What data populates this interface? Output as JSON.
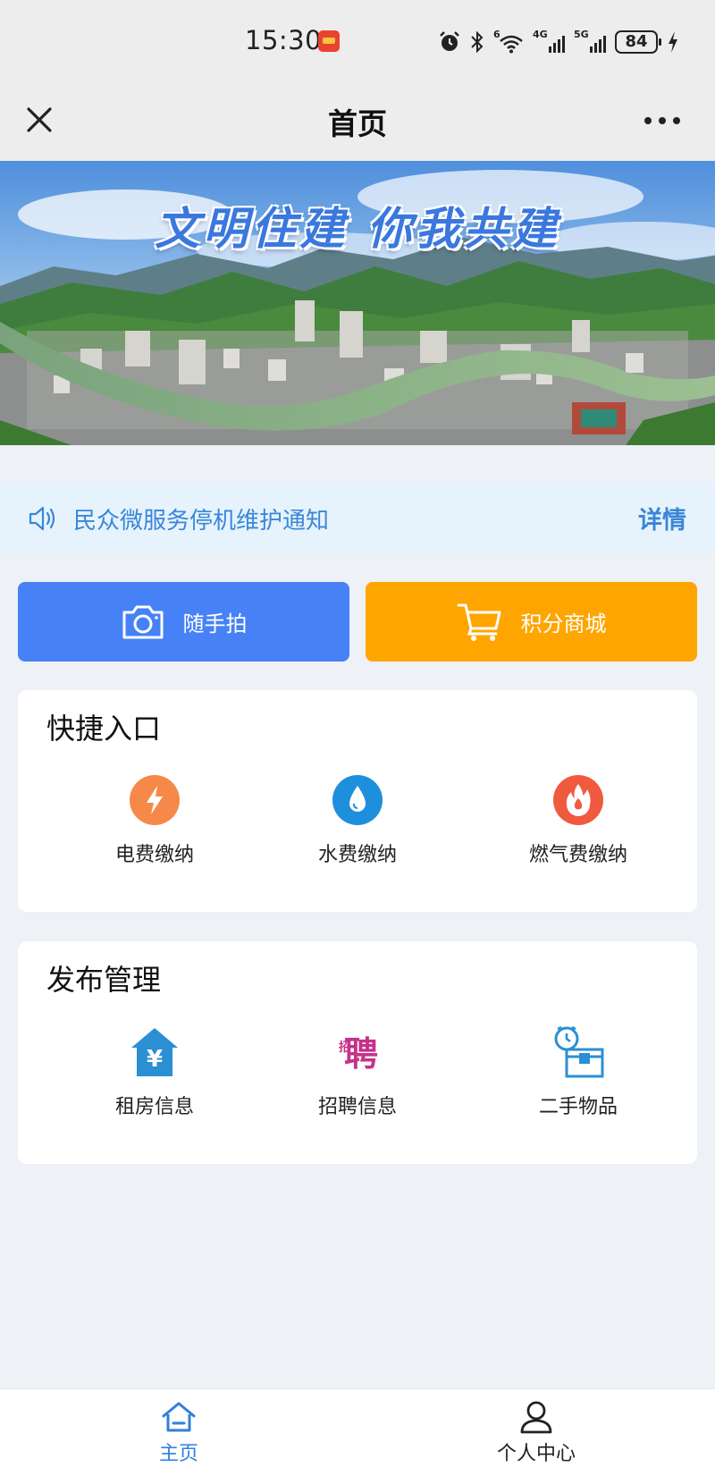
{
  "status_bar": {
    "time": "15:30",
    "net1_label": "4G",
    "net2_label": "5G",
    "battery": "84",
    "wifi_label": "6"
  },
  "nav": {
    "title": "首页"
  },
  "banner": {
    "slogan": "文明住建  你我共建"
  },
  "notice": {
    "text": "民众微服务停机维护通知",
    "detail_label": "详情"
  },
  "actions": {
    "photo_label": "随手拍",
    "mall_label": "积分商城"
  },
  "quick_entry": {
    "title": "快捷入口",
    "items": [
      {
        "label": "电费缴纳",
        "icon": "lightning-icon",
        "color": "#f6894a"
      },
      {
        "label": "水费缴纳",
        "icon": "water-drop-icon",
        "color": "#1e8fdc"
      },
      {
        "label": "燃气费缴纳",
        "icon": "flame-icon",
        "color": "#f05a3f"
      }
    ]
  },
  "publish": {
    "title": "发布管理",
    "items": [
      {
        "label": "租房信息",
        "icon": "house-yuan-icon",
        "color": "#2b8fd4",
        "glyph": "¥"
      },
      {
        "label": "招聘信息",
        "icon": "recruit-icon",
        "color": "#c5328a",
        "glyph": "聘",
        "small_glyph": "招"
      },
      {
        "label": "二手物品",
        "icon": "secondhand-box-icon",
        "color": "#2b8fd4"
      }
    ]
  },
  "tabbar": {
    "home_label": "主页",
    "me_label": "个人中心"
  },
  "colors": {
    "primary_blue": "#4681f6",
    "orange": "#fea500",
    "notice_bg": "#e6f3fd",
    "tab_active": "#2f7fdd"
  }
}
